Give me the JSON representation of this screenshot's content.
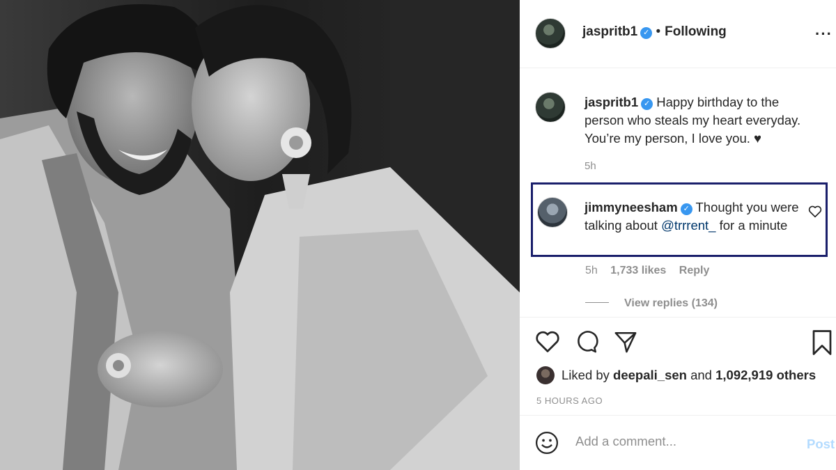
{
  "post": {
    "author": "jaspritb1",
    "follow_status": "Following",
    "more_icon": "more-horizontal-icon"
  },
  "caption": {
    "author": "jaspritb1",
    "text": "Happy birthday to the person who steals my heart everyday. You’re my person, I love you. ♥",
    "time": "5h"
  },
  "comment": {
    "author": "jimmyneesham",
    "text_before": "Thought you were talking about ",
    "mention": "@trrrent_",
    "text_after": " for a minute",
    "time": "5h",
    "likes": "1,733 likes",
    "reply_label": "Reply",
    "view_replies": "View replies (134)"
  },
  "engagement": {
    "liked_by_prefix": "Liked by",
    "liked_by_user": "deepali_sen",
    "and_label": "and",
    "others": "1,092,919 others",
    "posted_ago": "5 HOURS AGO"
  },
  "add_comment": {
    "placeholder": "Add a comment...",
    "post_label": "Post"
  },
  "colors": {
    "highlight_border": "#1a1f6b",
    "verified": "#3897f0",
    "mention": "#00376b",
    "post_disabled": "#b3dbff"
  }
}
